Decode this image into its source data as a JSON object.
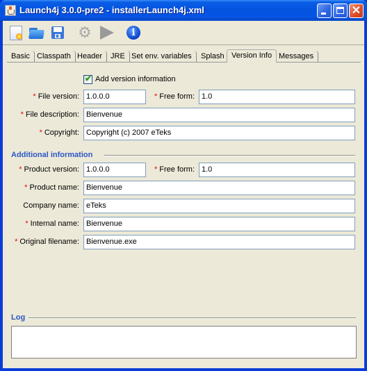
{
  "window": {
    "title": "Launch4j 3.0.0-pre2 - installerLaunch4j.xml",
    "controls": {
      "minimize": "_",
      "maximize": "□",
      "close": "✕"
    }
  },
  "toolbar": {
    "items": [
      {
        "name": "new-config",
        "icon": "new-document-icon"
      },
      {
        "name": "open-config",
        "icon": "folder-open-icon"
      },
      {
        "name": "save-config",
        "icon": "floppy-disk-icon"
      },
      {
        "name": "build-wrapper",
        "icon": "gear-icon",
        "glyph": "⚙"
      },
      {
        "name": "test-wrapper",
        "icon": "play-icon"
      },
      {
        "name": "about",
        "icon": "info-icon",
        "glyph": "i"
      }
    ]
  },
  "tabs": [
    {
      "label": "Basic"
    },
    {
      "label": "Classpath"
    },
    {
      "label": "Header"
    },
    {
      "label": "JRE"
    },
    {
      "label": "Set env. variables"
    },
    {
      "label": "Splash"
    },
    {
      "label": "Version Info",
      "active": true
    },
    {
      "label": "Messages"
    }
  ],
  "version_info": {
    "add_version_info": {
      "label": "Add version information",
      "checked": true,
      "check_glyph": "✔"
    },
    "required_marker": "*",
    "file_version": {
      "label": "File version:",
      "value": "1.0.0.0"
    },
    "file_free_form": {
      "label": "Free form:",
      "value": "1.0"
    },
    "file_description": {
      "label": "File description:",
      "value": "Bienvenue"
    },
    "copyright": {
      "label": "Copyright:",
      "value": "Copyright (c) 2007 eTeks"
    }
  },
  "additional_info": {
    "title": "Additional information",
    "product_version": {
      "label": "Product version:",
      "value": "1.0.0.0"
    },
    "product_free_form": {
      "label": "Free form:",
      "value": "1.0"
    },
    "product_name": {
      "label": "Product name:",
      "value": "Bienvenue"
    },
    "company_name": {
      "label": "Company name:",
      "value": "eTeks"
    },
    "internal_name": {
      "label": "Internal name:",
      "value": "Bienvenue"
    },
    "original_filename": {
      "label": "Original filename:",
      "value": "Bienvenue.exe"
    }
  },
  "log": {
    "title": "Log",
    "content": ""
  }
}
